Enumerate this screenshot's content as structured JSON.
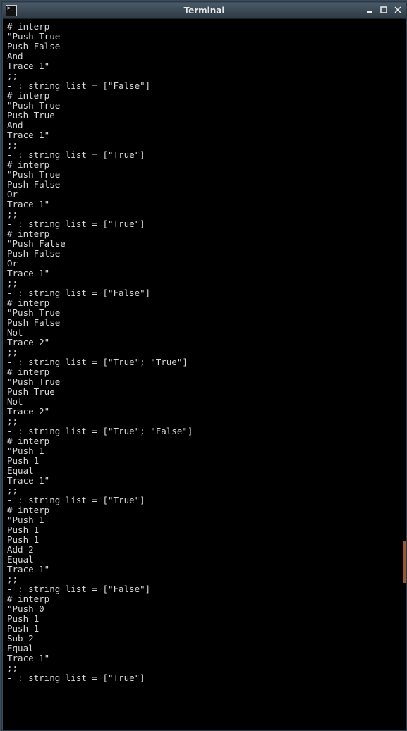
{
  "window": {
    "title": "Terminal"
  },
  "terminal_lines": [
    "# interp",
    "\"Push True",
    "Push False",
    "And",
    "Trace 1\"",
    ";;",
    "- : string list = [\"False\"]",
    "# interp",
    "\"Push True",
    "Push True",
    "And",
    "Trace 1\"",
    ";;",
    "- : string list = [\"True\"]",
    "# interp",
    "\"Push True",
    "Push False",
    "Or",
    "Trace 1\"",
    ";;",
    "- : string list = [\"True\"]",
    "# interp",
    "\"Push False",
    "Push False",
    "Or",
    "Trace 1\"",
    ";;",
    "- : string list = [\"False\"]",
    "# interp",
    "\"Push True",
    "Push False",
    "Not",
    "Trace 2\"",
    ";;",
    "- : string list = [\"True\"; \"True\"]",
    "# interp",
    "\"Push True",
    "Push True",
    "Not",
    "Trace 2\"",
    ";;",
    "- : string list = [\"True\"; \"False\"]",
    "# interp",
    "\"Push 1",
    "Push 1",
    "Equal",
    "Trace 1\"",
    ";;",
    "- : string list = [\"True\"]",
    "# interp",
    "\"Push 1",
    "Push 1",
    "Push 1",
    "Add 2",
    "Equal",
    "Trace 1\"",
    ";;",
    "- : string list = [\"False\"]",
    "# interp",
    "\"Push 0",
    "Push 1",
    "Push 1",
    "Sub 2",
    "Equal",
    "Trace 1\"",
    ";;",
    "- : string list = [\"True\"]"
  ]
}
